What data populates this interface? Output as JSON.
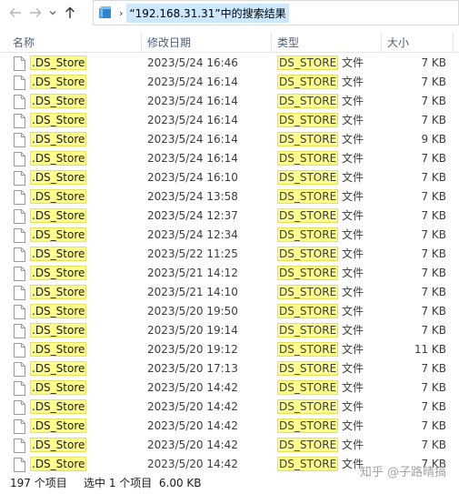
{
  "address": {
    "crumb": "“192.168.31.31”中的搜索结果"
  },
  "columns": {
    "name": "名称",
    "date": "修改日期",
    "type": "类型",
    "size": "大小"
  },
  "files": [
    {
      "name": ".DS_Store",
      "date": "2023/5/24 16:46",
      "type_hl": "DS_STORE",
      "type_suffix": " 文件",
      "size": "7 KB"
    },
    {
      "name": ".DS_Store",
      "date": "2023/5/24 16:14",
      "type_hl": "DS_STORE",
      "type_suffix": " 文件",
      "size": "7 KB"
    },
    {
      "name": ".DS_Store",
      "date": "2023/5/24 16:14",
      "type_hl": "DS_STORE",
      "type_suffix": " 文件",
      "size": "7 KB"
    },
    {
      "name": ".DS_Store",
      "date": "2023/5/24 16:14",
      "type_hl": "DS_STORE",
      "type_suffix": " 文件",
      "size": "7 KB"
    },
    {
      "name": ".DS_Store",
      "date": "2023/5/24 16:14",
      "type_hl": "DS_STORE",
      "type_suffix": " 文件",
      "size": "9 KB"
    },
    {
      "name": ".DS_Store",
      "date": "2023/5/24 16:14",
      "type_hl": "DS_STORE",
      "type_suffix": " 文件",
      "size": "7 KB"
    },
    {
      "name": ".DS_Store",
      "date": "2023/5/24 16:10",
      "type_hl": "DS_STORE",
      "type_suffix": " 文件",
      "size": "7 KB"
    },
    {
      "name": ".DS_Store",
      "date": "2023/5/24 13:58",
      "type_hl": "DS_STORE",
      "type_suffix": " 文件",
      "size": "7 KB"
    },
    {
      "name": ".DS_Store",
      "date": "2023/5/24 12:37",
      "type_hl": "DS_STORE",
      "type_suffix": " 文件",
      "size": "7 KB"
    },
    {
      "name": ".DS_Store",
      "date": "2023/5/24 12:34",
      "type_hl": "DS_STORE",
      "type_suffix": " 文件",
      "size": "7 KB"
    },
    {
      "name": ".DS_Store",
      "date": "2023/5/22 11:25",
      "type_hl": "DS_STORE",
      "type_suffix": " 文件",
      "size": "7 KB"
    },
    {
      "name": ".DS_Store",
      "date": "2023/5/21 14:12",
      "type_hl": "DS_STORE",
      "type_suffix": " 文件",
      "size": "7 KB"
    },
    {
      "name": ".DS_Store",
      "date": "2023/5/21 14:10",
      "type_hl": "DS_STORE",
      "type_suffix": " 文件",
      "size": "7 KB"
    },
    {
      "name": ".DS_Store",
      "date": "2023/5/20 19:50",
      "type_hl": "DS_STORE",
      "type_suffix": " 文件",
      "size": "7 KB"
    },
    {
      "name": ".DS_Store",
      "date": "2023/5/20 19:14",
      "type_hl": "DS_STORE",
      "type_suffix": " 文件",
      "size": "7 KB"
    },
    {
      "name": ".DS_Store",
      "date": "2023/5/20 19:12",
      "type_hl": "DS_STORE",
      "type_suffix": " 文件",
      "size": "11 KB"
    },
    {
      "name": ".DS_Store",
      "date": "2023/5/20 17:13",
      "type_hl": "DS_STORE",
      "type_suffix": " 文件",
      "size": "7 KB"
    },
    {
      "name": ".DS_Store",
      "date": "2023/5/20 14:42",
      "type_hl": "DS_STORE",
      "type_suffix": " 文件",
      "size": "7 KB"
    },
    {
      "name": ".DS_Store",
      "date": "2023/5/20 14:42",
      "type_hl": "DS_STORE",
      "type_suffix": " 文件",
      "size": "7 KB"
    },
    {
      "name": ".DS_Store",
      "date": "2023/5/20 14:42",
      "type_hl": "DS_STORE",
      "type_suffix": " 文件",
      "size": "7 KB"
    },
    {
      "name": ".DS_Store",
      "date": "2023/5/20 14:42",
      "type_hl": "DS_STORE",
      "type_suffix": " 文件",
      "size": "7 KB"
    },
    {
      "name": ".DS_Store",
      "date": "2023/5/20 14:42",
      "type_hl": "DS_STORE",
      "type_suffix": " 文件",
      "size": "7 KB"
    }
  ],
  "status": {
    "count": "197 个项目",
    "selection": "选中 1 个项目  6.00 KB"
  },
  "watermark": "知乎 @子路晴搞",
  "colors": {
    "highlight": "#ffff8c",
    "breadcrumb_bg": "#cce8ff",
    "header_text": "#4c607a"
  },
  "icons": {
    "back": "arrow-left-icon",
    "forward": "arrow-right-icon",
    "recent": "chevron-down-icon",
    "up": "arrow-up-icon",
    "location": "folder-icon",
    "file": "file-icon"
  }
}
